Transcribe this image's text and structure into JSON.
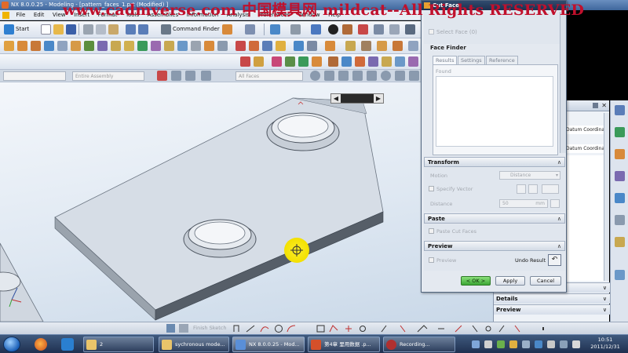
{
  "window": {
    "title": "NX 8.0.0.25 - Modeling - [pattern_faces_1.prt (Modified) ]"
  },
  "watermark": {
    "text": "www.cadmverse.com 中国模具网 mildcat--All Rights RESERVED"
  },
  "menubar": {
    "items": [
      "File",
      "Edit",
      "View",
      "Insert",
      "Format",
      "Tools",
      "Assemblies",
      "Information",
      "Analysis",
      "Preferences",
      "Window",
      "Help"
    ]
  },
  "toolbar": {
    "start_label": "Start",
    "command_finder_label": "Command Finder"
  },
  "selection_bar": {
    "filter1_placeholder": "",
    "filter2_placeholder": "Entire Assembly",
    "filter3_placeholder": "All Faces"
  },
  "dialog": {
    "title": "Cut Face",
    "select_face_label": "Select Face (0)",
    "face_finder_label": "Face Finder",
    "tabs": [
      "Results",
      "Settings",
      "Reference"
    ],
    "found_label": "Found",
    "transform_label": "Transform",
    "motion_label": "Motion",
    "motion_value": "Distance",
    "specify_vector_label": "Specify Vector",
    "distance_label": "Distance",
    "distance_value": "50",
    "distance_unit": "mm",
    "paste_label": "Paste",
    "paste_cut_faces_label": "Paste Cut Faces",
    "preview_section_label": "Preview",
    "preview_checkbox_label": "Preview",
    "undo_result_label": "Undo Result",
    "ok_label": "< OK >",
    "apply_label": "Apply",
    "cancel_label": "Cancel"
  },
  "side_panel": {
    "rows": [
      "Datum Coordinate System",
      "Datum Coordinate System"
    ],
    "sections": [
      "Details",
      "Preview"
    ]
  },
  "sketch_bar": {
    "finish_sketch_label": "Finish Sketch"
  },
  "taskbar": {
    "tasks": [
      {
        "label": "2"
      },
      {
        "label": "sychronous mode..."
      },
      {
        "label": "NX 8.0.0.25 - Mod..."
      },
      {
        "label": "第4章 里用数据 .p..."
      },
      {
        "label": "Recording..."
      }
    ],
    "clock_time": "10:51",
    "clock_date": "2011/12/31"
  },
  "colors": {
    "dialog_ok": "#3ba634",
    "title_bar": "#3e669c",
    "watermark": "#c0102c",
    "highlight_cursor": "#f5e400"
  }
}
